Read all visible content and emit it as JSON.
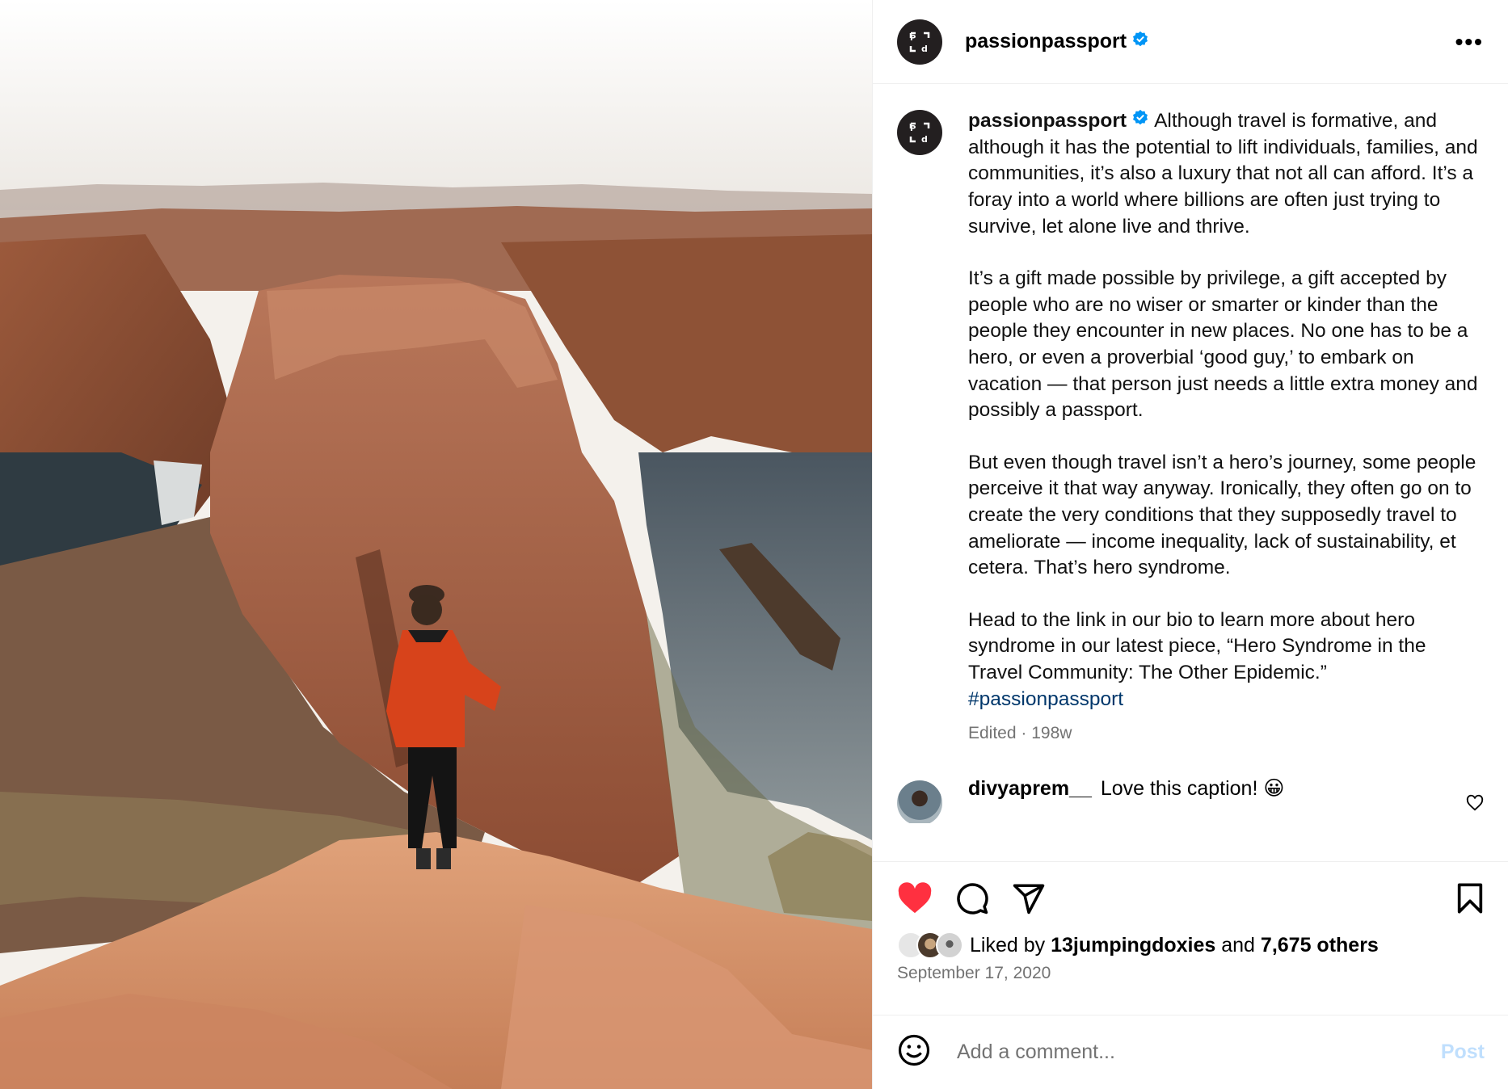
{
  "header": {
    "username": "passionpassport",
    "avatar_logo": "P┐\n└d",
    "verified_icon": "verified-badge-icon",
    "more_label": "•••"
  },
  "caption": {
    "username": "passionpassport",
    "paragraphs": [
      "Although travel is formative, and although it has the potential to lift individuals, families, and communities, it’s also a luxury that not all can afford. It’s a foray into a world where billions are often just trying to survive, let alone live and thrive.",
      "It’s a gift made possible by privilege, a gift accepted by people who are no wiser or smarter or kinder than the people they encounter in new places. No one has to be a hero, or even a proverbial ‘good guy,’ to embark on vacation — that person just needs a little extra money and possibly a passport.",
      "But even though travel isn’t a hero’s journey, some people perceive it that way anyway. Ironically, they often go on to create the very conditions that they supposedly travel to ameliorate — income inequality, lack of sustainability, et cetera. That’s hero syndrome.",
      "Head to the link in our bio to learn more about hero syndrome in our latest piece, “Hero Syndrome in the Travel Community: The Other Epidemic.”"
    ],
    "hashtag": "#passionpassport",
    "meta": "Edited · 198w"
  },
  "comment": {
    "username": "divyaprem__",
    "text": "Love this caption! 😀"
  },
  "likes": {
    "prefix": "Liked by",
    "user": "13jumpingdoxies",
    "middle": "and",
    "others": "7,675 others"
  },
  "date": "September 17, 2020",
  "add_comment": {
    "placeholder": "Add a comment...",
    "post_label": "Post"
  },
  "colors": {
    "heart": "#ff3040",
    "link": "#00376b",
    "verified": "#0095f6",
    "post_disabled": "#c0dffd"
  }
}
